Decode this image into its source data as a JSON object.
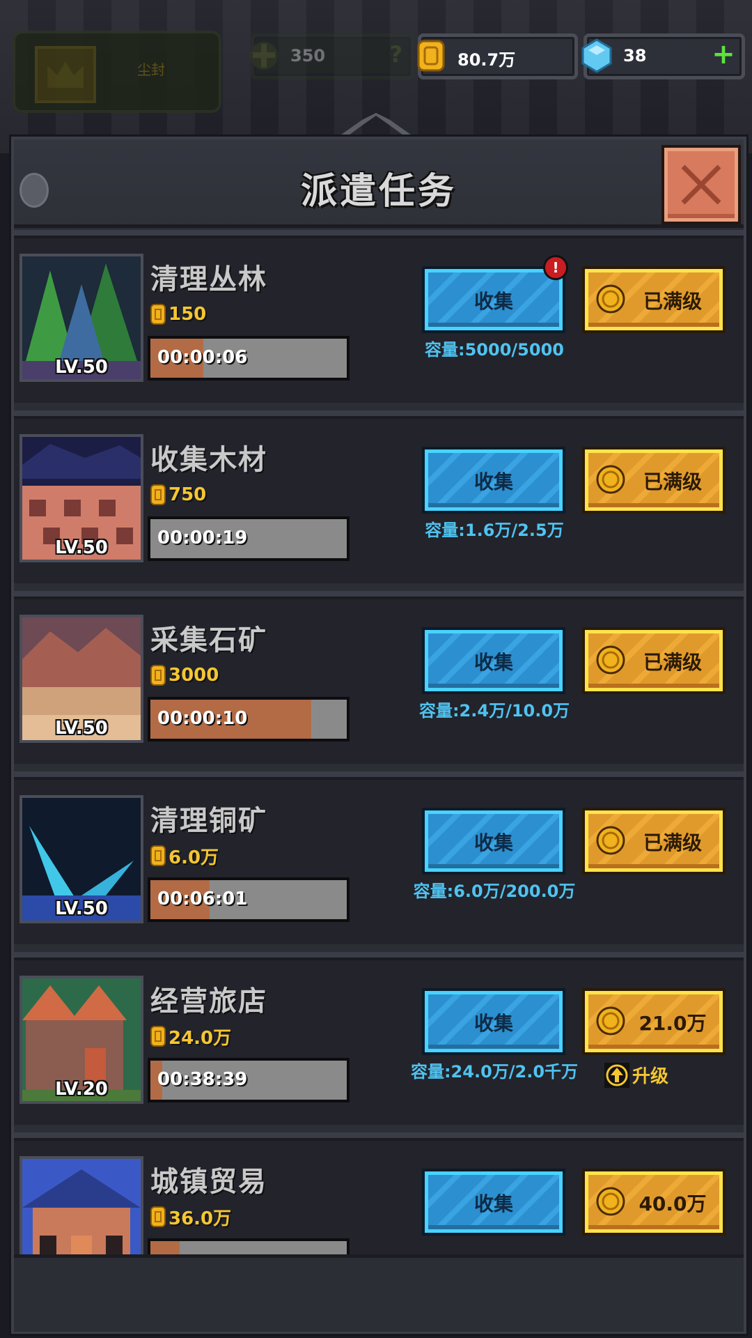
{
  "topbar": {
    "crown_label": "尘封",
    "token_value": "350",
    "token_help": "?",
    "gold_value": "80.7万",
    "gem_value": "38",
    "gem_plus": "+"
  },
  "panel": {
    "title": "派遣任务",
    "collect_label": "收集",
    "alert_mark": "!",
    "upgrade_link": "升级"
  },
  "tasks": [
    {
      "name": "清理丛林",
      "level": "LV.50",
      "reward": "150",
      "timer": "00:00:06",
      "progress": 0.27,
      "capacity": "容量:5000/5000",
      "upgrade": "已满级",
      "maxed": true
    },
    {
      "name": "收集木材",
      "level": "LV.50",
      "reward": "750",
      "timer": "00:00:19",
      "progress": 0.0,
      "capacity": "容量:1.6万/2.5万",
      "upgrade": "已满级",
      "maxed": true
    },
    {
      "name": "采集石矿",
      "level": "LV.50",
      "reward": "3000",
      "timer": "00:00:10",
      "progress": 0.82,
      "capacity": "容量:2.4万/10.0万",
      "upgrade": "已满级",
      "maxed": true
    },
    {
      "name": "清理铜矿",
      "level": "LV.50",
      "reward": "6.0万",
      "timer": "00:06:01",
      "progress": 0.3,
      "capacity": "容量:6.0万/200.0万",
      "upgrade": "已满级",
      "maxed": true
    },
    {
      "name": "经营旅店",
      "level": "LV.20",
      "reward": "24.0万",
      "timer": "00:38:39",
      "progress": 0.06,
      "capacity": "容量:24.0万/2.0千万",
      "upgrade": "21.0万",
      "maxed": false
    },
    {
      "name": "城镇贸易",
      "level": "",
      "reward": "36.0万",
      "timer": "",
      "progress": 0.15,
      "capacity": "",
      "upgrade": "40.0万",
      "maxed": false
    }
  ],
  "colors": {
    "collect_button": "#2c8fcf",
    "upgrade_button": "#e09a2c",
    "timer_fill": "#b26b45",
    "capacity_text": "#4fc3f0",
    "gold_text": "#f5c631"
  },
  "icons": [
    "crown-icon",
    "token-icon",
    "gold-coin-icon",
    "gem-icon",
    "plus-icon",
    "close-icon",
    "alert-icon",
    "level-up-arrow-icon"
  ]
}
